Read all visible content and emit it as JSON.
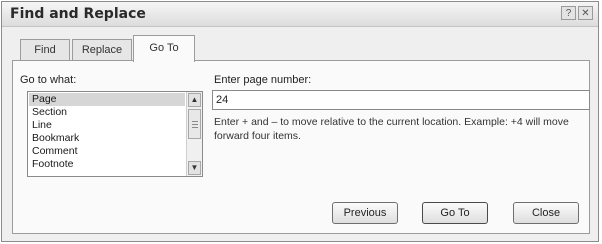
{
  "window": {
    "title": "Find and Replace",
    "help_label": "?",
    "close_label": "✕"
  },
  "tabs": [
    {
      "label": "Find",
      "active": false
    },
    {
      "label": "Replace",
      "active": false
    },
    {
      "label": "Go To",
      "active": true
    }
  ],
  "goto": {
    "label": "Go to what:",
    "items": [
      "Page",
      "Section",
      "Line",
      "Bookmark",
      "Comment",
      "Footnote"
    ],
    "selected": "Page"
  },
  "page_number": {
    "label": "Enter page number:",
    "value": "24",
    "help": "Enter + and – to move relative to the current location. Example: +4 will move forward four items."
  },
  "buttons": {
    "previous": "Previous",
    "goto": "Go To",
    "close": "Close"
  },
  "scrollbar": {
    "up_icon": "▲",
    "down_icon": "▼"
  }
}
